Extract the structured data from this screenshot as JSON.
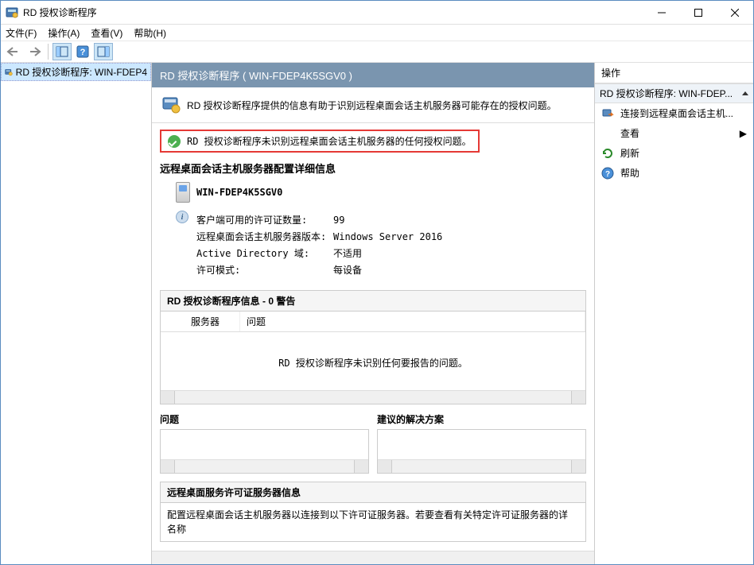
{
  "title": "RD 授权诊断程序",
  "menu": {
    "file": "文件(F)",
    "action": "操作(A)",
    "view": "查看(V)",
    "help": "帮助(H)"
  },
  "tree": {
    "root": "RD 授权诊断程序: WIN-FDEP4"
  },
  "main": {
    "header": "RD 授权诊断程序 ( WIN-FDEP4K5SGV0 )",
    "infoText": "RD 授权诊断程序提供的信息有助于识别远程桌面会话主机服务器可能存在的授权问题。",
    "statusText": "RD 授权诊断程序未识别远程桌面会话主机服务器的任何授权问题。",
    "configTitle": "远程桌面会话主机服务器配置详细信息",
    "serverName": "WIN-FDEP4K5SGV0",
    "details": [
      {
        "label": "客户端可用的许可证数量:",
        "value": "99"
      },
      {
        "label": "远程桌面会话主机服务器版本:",
        "value": "Windows Server 2016"
      },
      {
        "label": "Active Directory 域:",
        "value": "不适用"
      },
      {
        "label": "许可模式:",
        "value": "每设备"
      }
    ],
    "warningsTitle": "RD 授权诊断程序信息 - 0 警告",
    "gridCol1": "服务器",
    "gridCol2": "问题",
    "gridEmpty": "RD 授权诊断程序未识别任何要报告的问题。",
    "problemTitle": "问题",
    "solutionTitle": "建议的解决方案",
    "licTitle": "远程桌面服务许可证服务器信息",
    "licText": "配置远程桌面会话主机服务器以连接到以下许可证服务器。若要查看有关特定许可证服务器的详\n名称"
  },
  "actions": {
    "header": "操作",
    "subHeader": "RD 授权诊断程序: WIN-FDEP...",
    "items": [
      {
        "label": "连接到远程桌面会话主机...",
        "icon": "connect"
      },
      {
        "label": "查看",
        "icon": "none",
        "arrow": true
      },
      {
        "label": "刷新",
        "icon": "refresh"
      },
      {
        "label": "帮助",
        "icon": "help"
      }
    ]
  }
}
